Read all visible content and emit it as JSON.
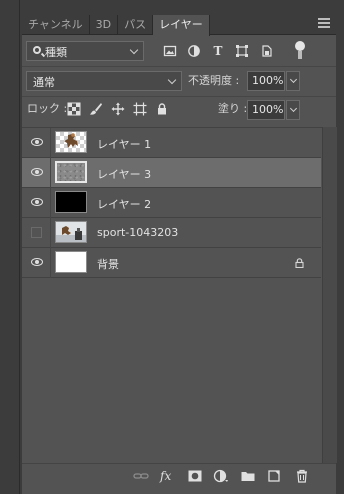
{
  "tabs": [
    {
      "label": "チャンネル",
      "active": false
    },
    {
      "label": "3D",
      "active": false
    },
    {
      "label": "パス",
      "active": false
    },
    {
      "label": "レイヤー",
      "active": true
    }
  ],
  "filter": {
    "kind_label": "種類"
  },
  "blend": {
    "mode": "通常",
    "opacity_label": "不透明度 :",
    "opacity_value": "100%"
  },
  "lock": {
    "label": "ロック :",
    "fill_label": "塗り :",
    "fill_value": "100%"
  },
  "layers": [
    {
      "name": "レイヤー 1",
      "visible": true,
      "selected": false,
      "thumb": "transparent-figure"
    },
    {
      "name": "レイヤー 3",
      "visible": true,
      "selected": true,
      "thumb": "noise"
    },
    {
      "name": "レイヤー 2",
      "visible": true,
      "selected": false,
      "thumb": "black"
    },
    {
      "name": "sport-1043203",
      "visible": false,
      "selected": false,
      "thumb": "photo"
    },
    {
      "name": "背景",
      "visible": true,
      "selected": false,
      "thumb": "white",
      "locked": true
    }
  ],
  "bottom_icons": [
    "link-layers-icon",
    "fx-icon",
    "add-mask-icon",
    "adjustment-layer-icon",
    "new-group-icon",
    "new-layer-icon",
    "trash-icon"
  ],
  "fx_label": "fx",
  "colors": {
    "panel_bg": "#535353",
    "selected_row": "#6d6d6d",
    "tab_bar": "#3c3c3c"
  }
}
